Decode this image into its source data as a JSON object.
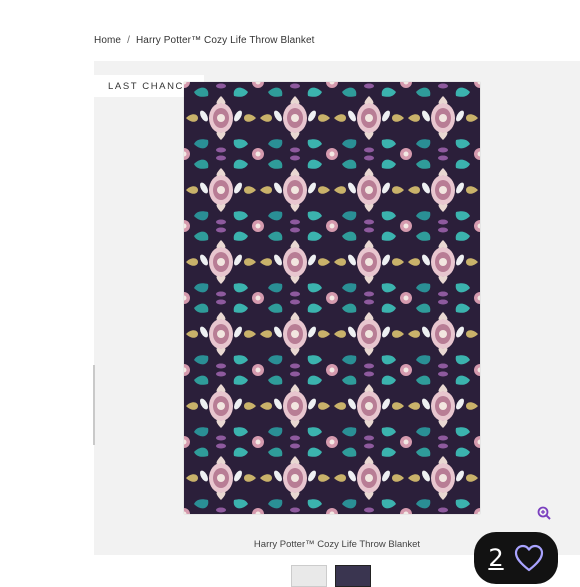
{
  "breadcrumb": {
    "home": "Home",
    "separator": "/",
    "current": "Harry Potter™ Cozy Life Throw Blanket"
  },
  "product": {
    "badge": "LAST CHANCE",
    "image_caption": "Harry Potter™ Cozy Life Throw Blanket"
  },
  "favorites": {
    "count": "2"
  },
  "icons": {
    "zoom": "zoom-in-icon",
    "heart": "heart-outline-icon"
  },
  "colors": {
    "accent": "#7a3fbf",
    "blanket_base": "#2b1f3a",
    "fav_pill": "#121212",
    "heart": "#a9a3ff"
  }
}
